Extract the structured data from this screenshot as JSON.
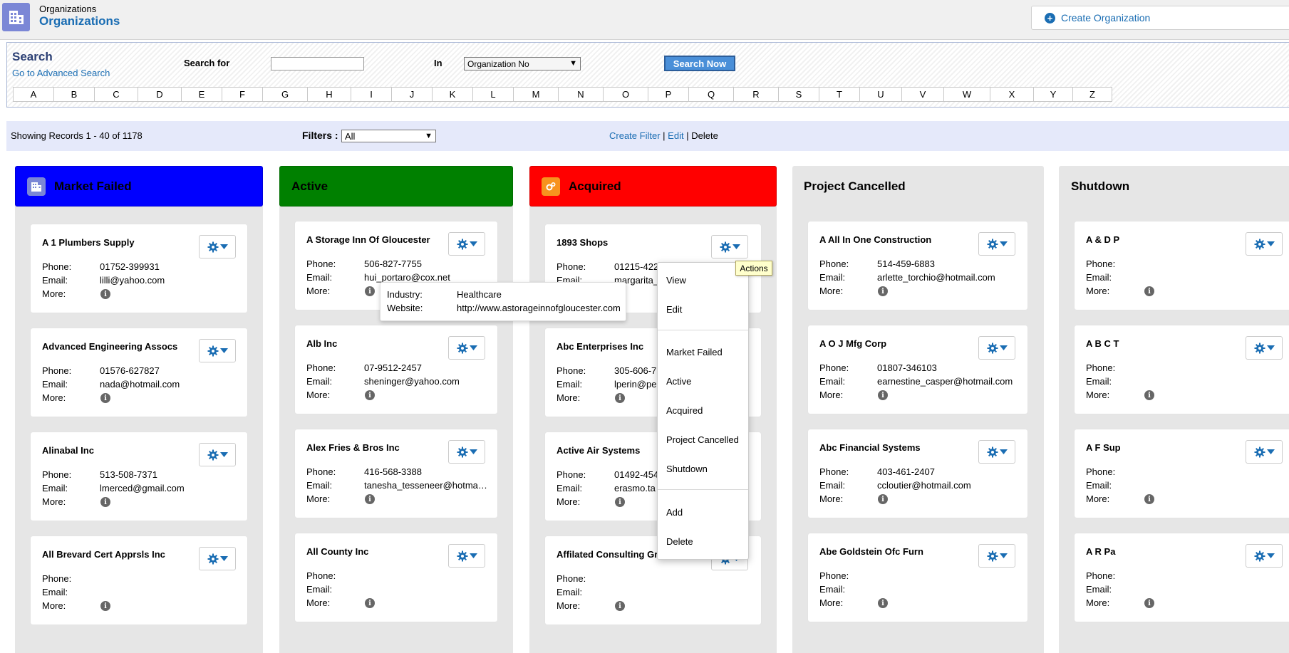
{
  "header": {
    "breadcrumb": "Organizations",
    "title": "Organizations",
    "create_button": "Create Organization"
  },
  "search": {
    "title": "Search",
    "advanced_link": "Go to Advanced Search",
    "search_for_label": "Search for",
    "search_input_value": "",
    "in_label": "In",
    "in_selected": "Organization No",
    "search_button": "Search Now",
    "alphabet": [
      "A",
      "B",
      "C",
      "D",
      "E",
      "F",
      "G",
      "H",
      "I",
      "J",
      "K",
      "L",
      "M",
      "N",
      "O",
      "P",
      "Q",
      "R",
      "S",
      "T",
      "U",
      "V",
      "W",
      "X",
      "Y",
      "Z"
    ]
  },
  "records": {
    "showing": "Showing Records 1 - 40 of 1178",
    "filters_label": "Filters :",
    "filter_selected": "All",
    "create_filter": "Create Filter",
    "sep1": "|",
    "edit": "Edit",
    "sep2": "|",
    "delete": "Delete"
  },
  "labels": {
    "phone": "Phone:",
    "email": "Email:",
    "more": "More:"
  },
  "columns": [
    {
      "title": "Market Failed",
      "color": "#0000ff",
      "icon": "building-icon",
      "cards": [
        {
          "name": "A 1 Plumbers Supply",
          "phone": "01752-399931",
          "email": "lilli@yahoo.com"
        },
        {
          "name": "Advanced Engineering Assocs",
          "phone": "01576-627827",
          "email": "nada@hotmail.com"
        },
        {
          "name": "Alinabal Inc",
          "phone": "513-508-7371",
          "email": "lmerced@gmail.com"
        },
        {
          "name": "All Brevard Cert Apprsls Inc",
          "phone": "",
          "email": ""
        }
      ]
    },
    {
      "title": "Active",
      "color": "#008000",
      "icon": "",
      "cards": [
        {
          "name": "A Storage Inn Of Gloucester",
          "phone": "506-827-7755",
          "email": "hui_portaro@cox.net"
        },
        {
          "name": "Alb Inc",
          "phone": "07-9512-2457",
          "email": "sheninger@yahoo.com"
        },
        {
          "name": "Alex Fries & Bros Inc",
          "phone": "416-568-3388",
          "email": "tanesha_tesseneer@hotmail.com"
        },
        {
          "name": "All County Inc",
          "phone": "",
          "email": ""
        }
      ]
    },
    {
      "title": "Acquired",
      "color": "#ff0000",
      "icon": "gears-icon",
      "cards": [
        {
          "name": "1893 Shops",
          "phone": "01215-422",
          "email": "margarita_"
        },
        {
          "name": "Abc Enterprises Inc",
          "phone": "305-606-7",
          "email": "lperin@pe"
        },
        {
          "name": "Active Air Systems",
          "phone": "01492-454",
          "email": "erasmo.ta"
        },
        {
          "name": "Affilated Consulting Gr",
          "phone": "",
          "email": ""
        }
      ]
    },
    {
      "title": "Project Cancelled",
      "color": "#e6e6e6",
      "icon": "",
      "cards": [
        {
          "name": "A All In One Construction",
          "phone": "514-459-6883",
          "email": "arlette_torchio@hotmail.com"
        },
        {
          "name": "A O J Mfg Corp",
          "phone": "01807-346103",
          "email": "earnestine_casper@hotmail.com"
        },
        {
          "name": "Abc Financial Systems",
          "phone": "403-461-2407",
          "email": "ccloutier@hotmail.com"
        },
        {
          "name": "Abe Goldstein Ofc Furn",
          "phone": "",
          "email": ""
        }
      ]
    },
    {
      "title": "Shutdown",
      "color": "#e6e6e6",
      "icon": "",
      "cards": [
        {
          "name": "A & D P",
          "phone": "",
          "email": ""
        },
        {
          "name": "A B C T",
          "phone": "",
          "email": ""
        },
        {
          "name": "A F Sup",
          "phone": "",
          "email": ""
        },
        {
          "name": "A R Pa",
          "phone": "",
          "email": ""
        }
      ]
    }
  ],
  "popover": {
    "industry_label": "Industry:",
    "industry_value": "Healthcare",
    "website_label": "Website:",
    "website_value": "http://www.astorageinnofgloucester.com"
  },
  "menu": {
    "items": [
      "View",
      "Edit",
      "Market Failed",
      "Active",
      "Acquired",
      "Project Cancelled",
      "Shutdown",
      "Add",
      "Delete"
    ]
  },
  "tooltip": "Actions"
}
